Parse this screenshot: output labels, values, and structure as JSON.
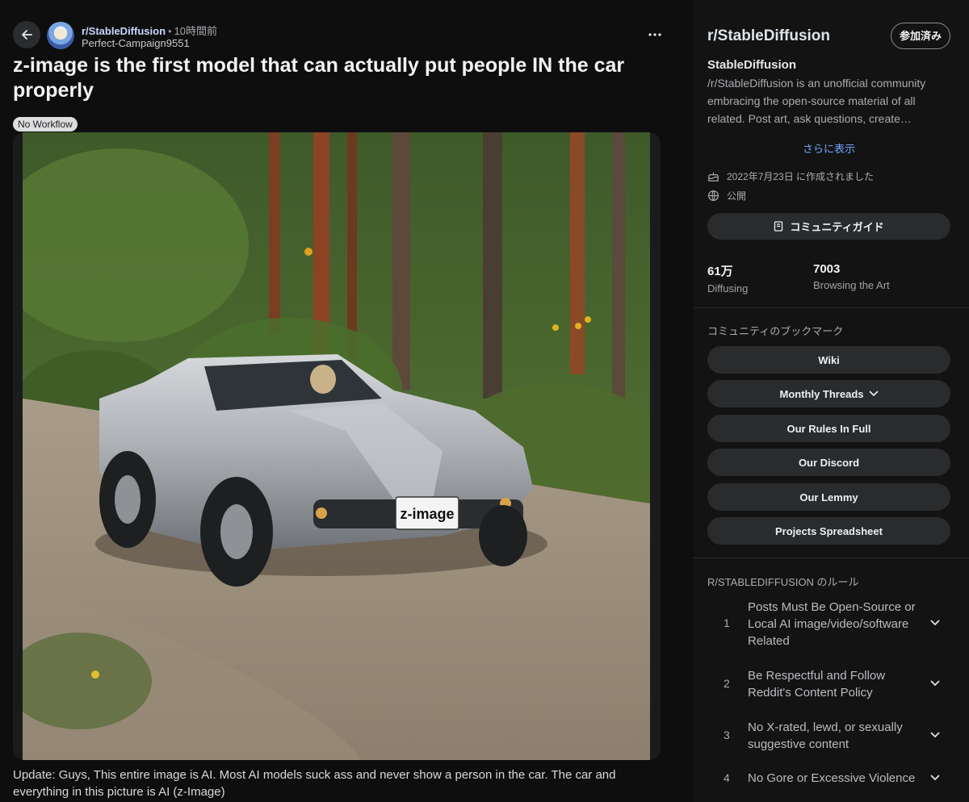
{
  "post": {
    "subreddit": "r/StableDiffusion",
    "time_ago": "10時間前",
    "author": "Perfect-Campaign9551",
    "title": "z-image is the first model that can actually put people IN the car properly",
    "flair": "No Workflow",
    "plate_text": "z-image",
    "body": "Update: Guys, This entire image is AI. Most AI models suck ass and never show a person in the car. The car and everything in this picture is AI (z-Image)"
  },
  "sidebar": {
    "title": "r/StableDiffusion",
    "join_label": "参加済み",
    "name": "StableDiffusion",
    "description": "/r/StableDiffusion is an unofficial community embracing the open-source material of all related. Post art, ask questions, create…",
    "show_more": "さらに表示",
    "created": "2022年7月23日 に作成されました",
    "visibility": "公開",
    "guide_label": "コミュニティガイド",
    "stats": [
      {
        "value": "61万",
        "label": "Diffusing"
      },
      {
        "value": "7003",
        "label": "Browsing the Art"
      }
    ],
    "bookmarks_title": "コミュニティのブックマーク",
    "bookmarks": [
      "Wiki",
      "Monthly Threads",
      "Our Rules In Full",
      "Our Discord",
      "Our Lemmy",
      "Projects Spreadsheet"
    ],
    "rules_title": "R/STABLEDIFFUSION のルール",
    "rules": [
      {
        "num": "1",
        "text": "Posts Must Be Open-Source or Local AI image/video/software Related"
      },
      {
        "num": "2",
        "text": "Be Respectful and Follow Reddit's Content Policy"
      },
      {
        "num": "3",
        "text": "No X-rated, lewd, or sexually suggestive content"
      },
      {
        "num": "4",
        "text": "No Gore or Excessive Violence"
      }
    ]
  },
  "colors": {
    "background": "#0e0e0f",
    "sidebar": "#131314",
    "button": "#2a2b2d",
    "link": "#6fa8ff"
  }
}
